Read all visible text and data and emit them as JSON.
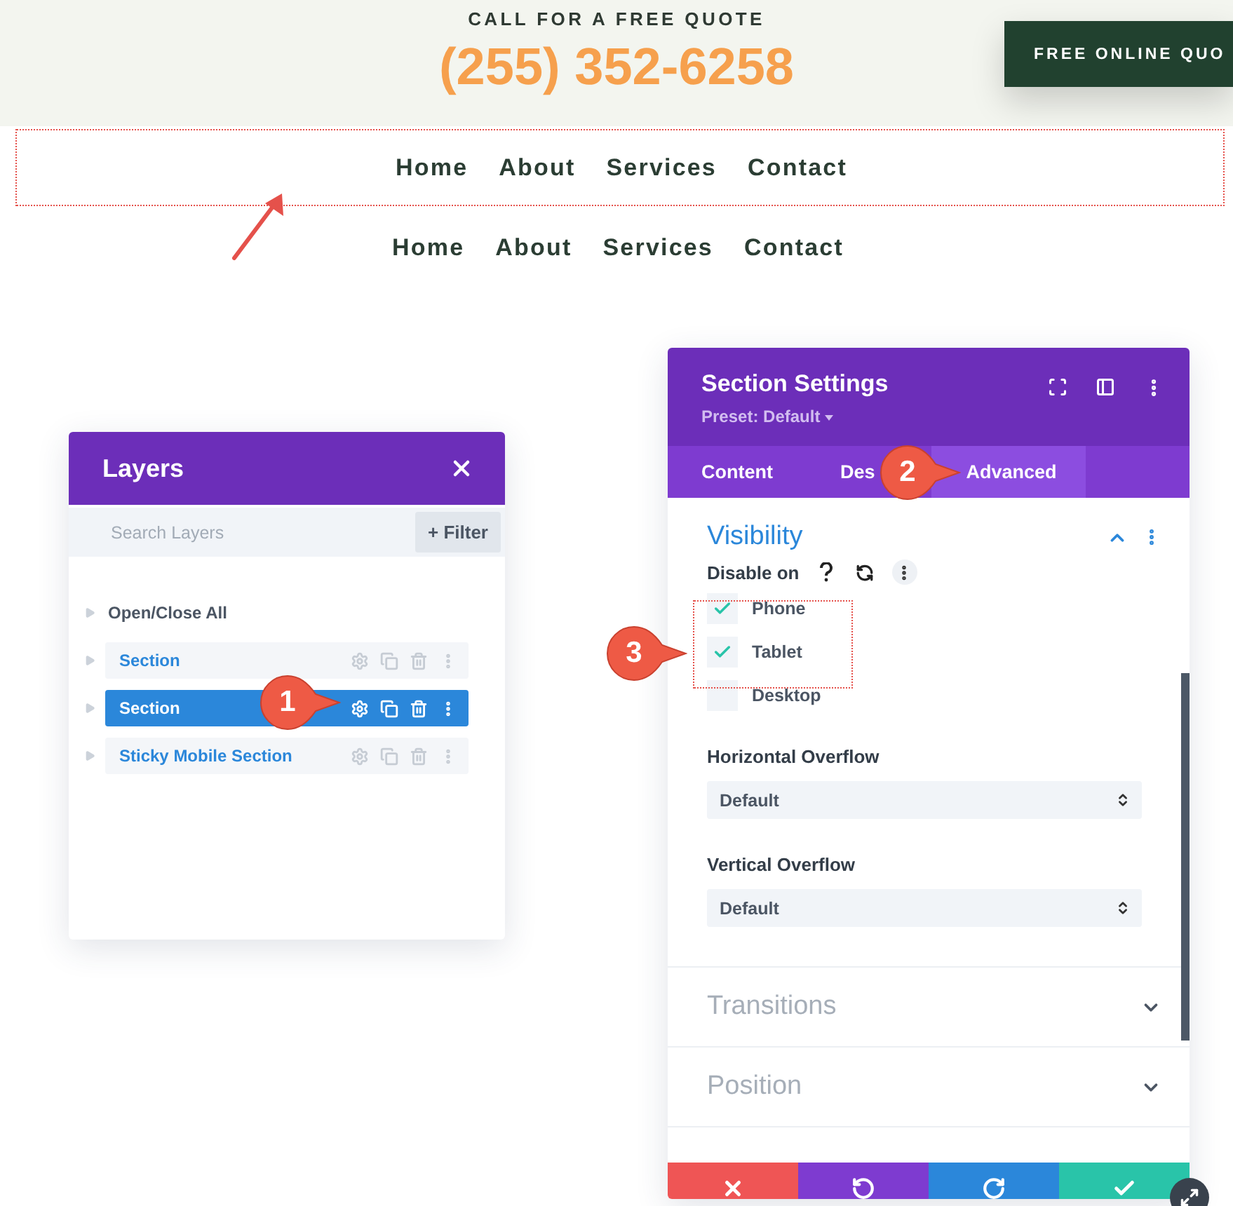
{
  "header": {
    "tagline": "CALL FOR A FREE QUOTE",
    "phone": "(255) 352-6258",
    "cta_button": "FREE ONLINE QUO"
  },
  "nav_menus": [
    {
      "highlighted": true,
      "items": [
        "Home",
        "About",
        "Services",
        "Contact"
      ]
    },
    {
      "highlighted": false,
      "items": [
        "Home",
        "About",
        "Services",
        "Contact"
      ]
    }
  ],
  "layers_panel": {
    "title": "Layers",
    "search": {
      "placeholder": "Search Layers"
    },
    "filter_button": "+ Filter",
    "toggle_all": "Open/Close All",
    "items": [
      {
        "label": "Section",
        "selected": false
      },
      {
        "label": "Section",
        "selected": true
      },
      {
        "label": "Sticky Mobile Section",
        "selected": false
      }
    ]
  },
  "settings_panel": {
    "title": "Section Settings",
    "preset": "Preset: Default",
    "tabs": [
      {
        "label": "Content",
        "selected": false
      },
      {
        "label": "Des",
        "selected": false
      },
      {
        "label": "Advanced",
        "selected": true
      }
    ],
    "sections": [
      {
        "title": "Visibility",
        "expanded": true
      },
      {
        "title": "Transitions",
        "expanded": false
      },
      {
        "title": "Position",
        "expanded": false
      }
    ],
    "disable_label": "Disable on",
    "options": [
      {
        "label": "Phone",
        "checked": true
      },
      {
        "label": "Tablet",
        "checked": true
      },
      {
        "label": "Desktop",
        "checked": false
      }
    ],
    "fields": [
      {
        "label": "Horizontal Overflow",
        "value": "Default"
      },
      {
        "label": "Vertical Overflow",
        "value": "Default"
      }
    ]
  },
  "callouts": [
    "1",
    "2",
    "3"
  ]
}
